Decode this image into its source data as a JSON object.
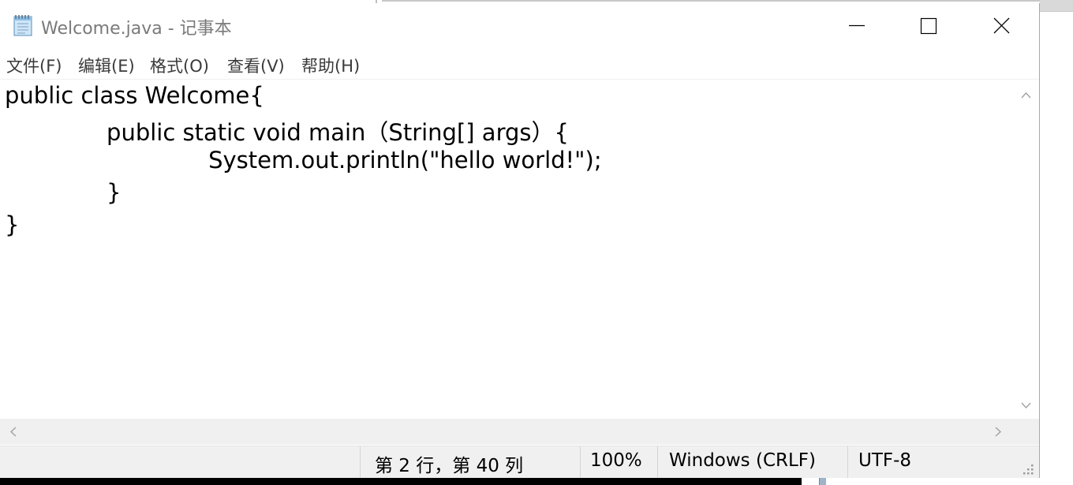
{
  "window": {
    "title": "Welcome.java - 记事本"
  },
  "menu": {
    "items": [
      {
        "label": "文件(F)"
      },
      {
        "label": "编辑(E)"
      },
      {
        "label": "格式(O)"
      },
      {
        "label": "查看(V)"
      },
      {
        "label": "帮助(H)"
      }
    ]
  },
  "editor": {
    "lines": [
      "public class Welcome{",
      "              public static void main（String[] args）{",
      "                            System.out.println(\"hello world!\");",
      "              }",
      "}"
    ]
  },
  "status": {
    "position": "第 2 行，第 40 列",
    "zoom": "100%",
    "line_ending": "Windows (CRLF)",
    "encoding": "UTF-8"
  },
  "icons": {
    "app": "notepad-icon",
    "minimize": "minimize-icon",
    "maximize": "maximize-icon",
    "close": "close-icon",
    "scroll_up": "chevron-up-icon",
    "scroll_down": "chevron-down-icon",
    "scroll_left": "chevron-left-icon",
    "scroll_right": "chevron-right-icon",
    "resize": "resize-grip-icon"
  }
}
